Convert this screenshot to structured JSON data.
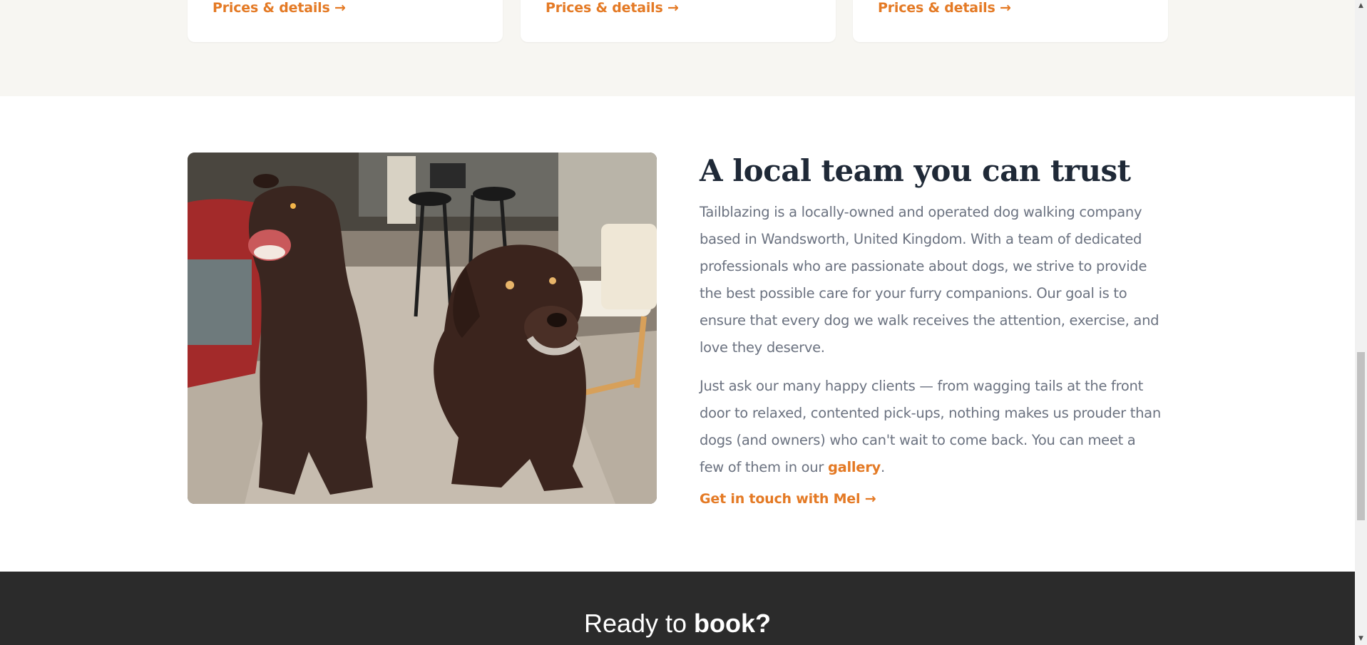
{
  "services": {
    "cards": [
      {
        "link": "Prices & details →"
      },
      {
        "link": "Prices & details →"
      },
      {
        "link": "Prices & details →"
      }
    ]
  },
  "about": {
    "title": "A local team you can trust",
    "paragraph1": "Tailblazing is a locally-owned and operated dog walking company based in Wandsworth, United Kingdom. With a team of dedicated professionals who are passionate about dogs, we strive to provide the best possible care for your furry companions. Our goal is to ensure that every dog we walk receives the attention, exercise, and love they deserve.",
    "paragraph2_before": "Just ask our many happy clients — from wagging tails at the front door to relaxed, contented pick-ups, nothing makes us prouder than dogs (and owners) who can't wait to come back. You can meet a few of them in our ",
    "paragraph2_link": "gallery",
    "paragraph2_after": ".",
    "cta": "Get in touch with Mel →"
  },
  "book": {
    "title_plain": "Ready to ",
    "title_bold": "book?"
  },
  "colors": {
    "accent": "#e47a25",
    "heading": "#1f2937",
    "body_text": "#6b7280",
    "strip_bg": "#f7f6f2",
    "footer_bg": "#2b2b2b"
  },
  "icons": {
    "scroll_up": "▲",
    "scroll_down": "▼"
  }
}
